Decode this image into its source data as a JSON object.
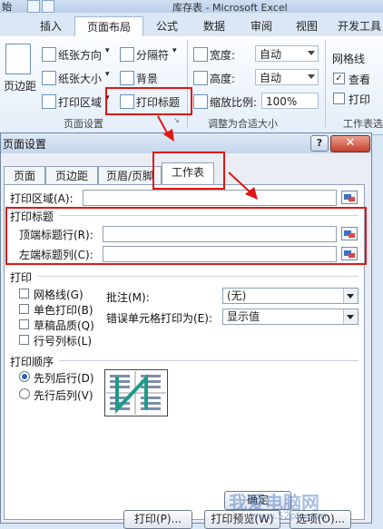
{
  "titlebar": {
    "left_fragment": "始",
    "title": "库存表 - Microsoft Excel"
  },
  "ribbon_tabs": [
    "插入",
    "页面布局",
    "公式",
    "数据",
    "审阅",
    "视图",
    "开发工具"
  ],
  "ribbon": {
    "margins": "页边距",
    "orientation": "纸张方向",
    "size": "纸张大小",
    "print_area": "打印区域",
    "breaks": "分隔符",
    "background": "背景",
    "print_titles": "打印标题",
    "group_page_setup": "页面设置",
    "width_label": "宽度:",
    "width_value": "自动",
    "height_label": "高度:",
    "height_value": "自动",
    "scale_label": "缩放比例:",
    "scale_value": "100%",
    "group_scale": "调整为合适大小",
    "gridlines": "网格线",
    "view": "查看",
    "print": "打印",
    "group_sheet": "工作表选"
  },
  "dialog": {
    "title": "页面设置",
    "help": "?",
    "close": "✕",
    "tabs": [
      "页面",
      "页边距",
      "页眉/页脚",
      "工作表"
    ],
    "print_area_label": "打印区域(A):",
    "print_titles_section": "打印标题",
    "rows_repeat_label": "顶端标题行(R):",
    "cols_repeat_label": "左端标题列(C):",
    "print_section": "打印",
    "checkboxes": [
      "网格线(G)",
      "单色打印(B)",
      "草稿品质(Q)",
      "行号列标(L)"
    ],
    "comments_label": "批注(M):",
    "comments_value": "(无)",
    "errors_label": "错误单元格打印为(E):",
    "errors_value": "显示值",
    "order_section": "打印顺序",
    "order_options": [
      "先列后行(D)",
      "先行后列(V)"
    ],
    "buttons": {
      "print": "打印(P)...",
      "preview": "打印预览(W)",
      "options": "选项(O)..."
    },
    "ok": "确定"
  },
  "watermark": {
    "main": "我爱电脑网",
    "sub": "www.52pk.com"
  },
  "colors": {
    "annotation": "#e01616",
    "accent": "#2a64c0"
  }
}
